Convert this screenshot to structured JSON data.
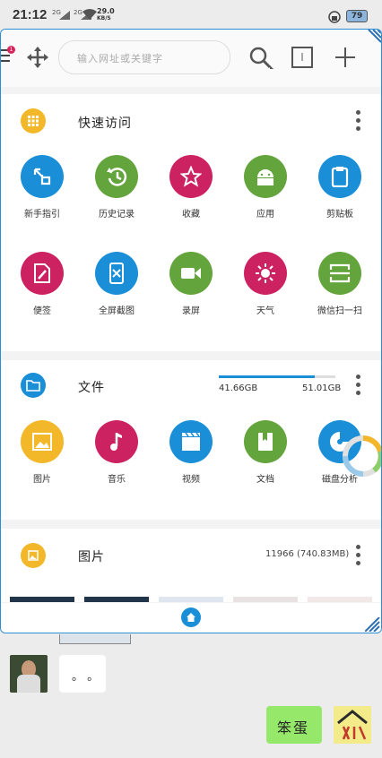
{
  "status": {
    "time": "21:12",
    "net1": "2G",
    "net2": "2G",
    "speed_value": "29.0",
    "speed_unit": "KB/S",
    "battery": "79"
  },
  "toolbar": {
    "search_placeholder": "输入网址或关键字",
    "notify_count": "1"
  },
  "quick": {
    "title": "快速访问",
    "items": [
      {
        "label": "新手指引",
        "color": "#1a8fd8",
        "icon": "touch-icon"
      },
      {
        "label": "历史记录",
        "color": "#64a43d",
        "icon": "history-icon"
      },
      {
        "label": "收藏",
        "color": "#cc2262",
        "icon": "star-icon"
      },
      {
        "label": "应用",
        "color": "#64a43d",
        "icon": "android-icon"
      },
      {
        "label": "剪贴板",
        "color": "#1a8fd8",
        "icon": "clipboard-icon"
      },
      {
        "label": "便签",
        "color": "#cc2262",
        "icon": "note-icon"
      },
      {
        "label": "全屏截图",
        "color": "#1a8fd8",
        "icon": "screenshot-icon"
      },
      {
        "label": "录屏",
        "color": "#64a43d",
        "icon": "video-icon"
      },
      {
        "label": "天气",
        "color": "#cc2262",
        "icon": "sun-icon"
      },
      {
        "label": "微信扫一扫",
        "color": "#64a43d",
        "icon": "scan-icon"
      }
    ]
  },
  "files": {
    "title": "文件",
    "used": "41.66GB",
    "total": "51.01GB",
    "used_fraction": 0.82,
    "items": [
      {
        "label": "图片",
        "color": "#f2b82a",
        "icon": "image-icon"
      },
      {
        "label": "音乐",
        "color": "#cc2262",
        "icon": "music-icon"
      },
      {
        "label": "视频",
        "color": "#1a8fd8",
        "icon": "film-icon"
      },
      {
        "label": "文档",
        "color": "#64a43d",
        "icon": "book-icon"
      },
      {
        "label": "磁盘分析",
        "color": "#1a8fd8",
        "icon": "disk-icon"
      }
    ]
  },
  "pictures": {
    "title": "图片",
    "count": "11966 (740.83MB)"
  },
  "chat": {
    "reply_text": "。 。",
    "my_text": "笨蛋"
  }
}
